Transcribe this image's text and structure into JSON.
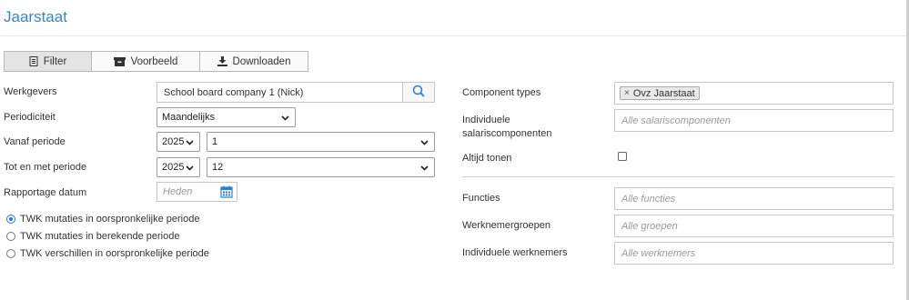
{
  "page": {
    "title": "Jaarstaat"
  },
  "tabs": [
    {
      "label": "Filter",
      "icon": "document-icon",
      "active": true
    },
    {
      "label": "Voorbeeld",
      "icon": "archive-box-icon",
      "active": false
    },
    {
      "label": "Downloaden",
      "icon": "download-icon",
      "active": false
    }
  ],
  "left": {
    "werkgevers_label": "Werkgevers",
    "werkgevers_value": "School board company 1 (Nick)",
    "periodiciteit_label": "Periodiciteit",
    "periodiciteit_value": "Maandelijks",
    "vanaf_label": "Vanaf periode",
    "vanaf_year": "2025",
    "vanaf_period": "1",
    "tot_label": "Tot en met periode",
    "tot_year": "2025",
    "tot_period": "12",
    "rapportage_label": "Rapportage datum",
    "rapportage_placeholder": "Heden",
    "radios": [
      {
        "label": "TWK mutaties in oorspronkelijke periode",
        "checked": true
      },
      {
        "label": "TWK mutaties in berekende periode",
        "checked": false
      },
      {
        "label": "TWK verschillen in oorspronkelijke periode",
        "checked": false
      }
    ]
  },
  "right": {
    "component_types_label": "Component types",
    "component_types_tag": "Ovz Jaarstaat",
    "individuele_label_line1": "Individuele",
    "individuele_label_line2": "salariscomponenten",
    "individuele_placeholder": "Alle salariscomponenten",
    "altijd_tonen_label": "Altijd tonen",
    "altijd_tonen_checked": false,
    "functies_label": "Functies",
    "functies_placeholder": "Alle functies",
    "werknemergroepen_label": "Werknemergroepen",
    "werknemergroepen_placeholder": "Alle groepen",
    "individuele_werknemers_label": "Individuele werknemers",
    "individuele_werknemers_placeholder": "Alle werknemers"
  },
  "colors": {
    "accent": "#3a86c8",
    "radio_checked": "#1a73e8",
    "calendar_icon": "#2a7fd4"
  }
}
